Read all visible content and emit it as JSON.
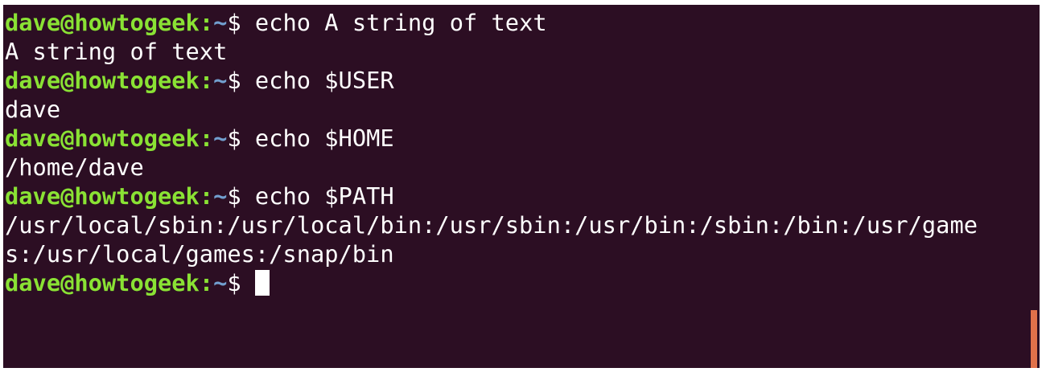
{
  "prompt": {
    "user_host": "dave@howtogeek",
    "colon": ":",
    "path": "~",
    "symbol": "$ "
  },
  "lines": [
    {
      "type": "prompt",
      "command": "echo A string of text"
    },
    {
      "type": "output",
      "text": "A string of text"
    },
    {
      "type": "prompt",
      "command": "echo $USER"
    },
    {
      "type": "output",
      "text": "dave"
    },
    {
      "type": "prompt",
      "command": "echo $HOME"
    },
    {
      "type": "output",
      "text": "/home/dave"
    },
    {
      "type": "prompt",
      "command": "echo $PATH"
    },
    {
      "type": "output",
      "text": "/usr/local/sbin:/usr/local/bin:/usr/sbin:/usr/bin:/sbin:/bin:/usr/game"
    },
    {
      "type": "output",
      "text": "s:/usr/local/games:/snap/bin"
    },
    {
      "type": "prompt",
      "command": ""
    }
  ],
  "colors": {
    "background": "#2c0e23",
    "user_host": "#8ae234",
    "path": "#729fcf",
    "text": "#ffffff",
    "scrollbar": "#e0714a"
  }
}
